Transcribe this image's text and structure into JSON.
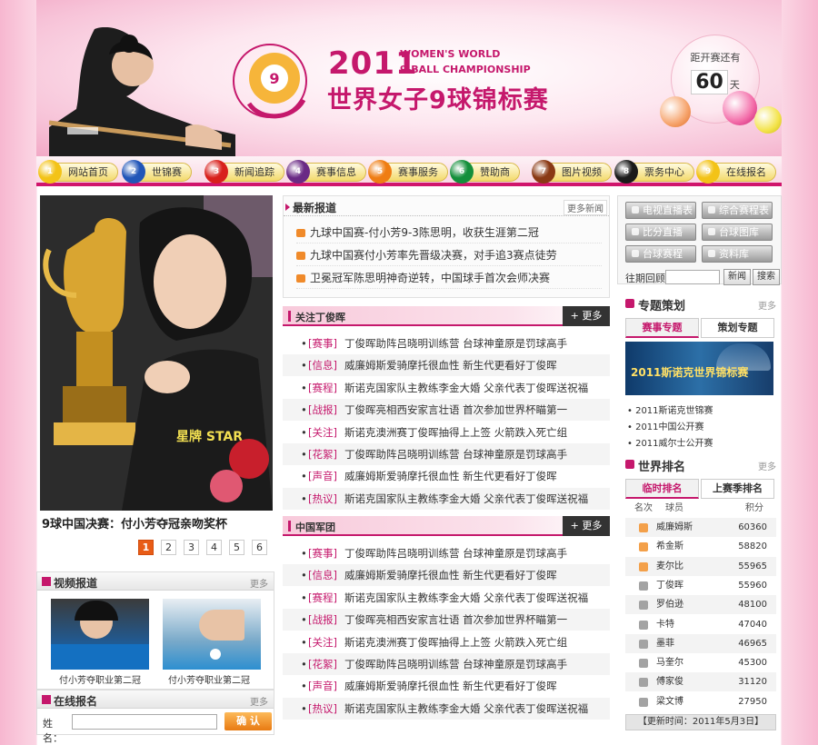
{
  "header": {
    "year": "2011",
    "en_line1": "WOMEN'S WORLD",
    "en_line2": "9-BALL CHAMPIONSHIP",
    "cn_title": "世界女子9球锦标赛",
    "countdown_top": "距开赛还有",
    "countdown_num": "60",
    "countdown_unit": "天",
    "logo_ring_text": "2011世界女子9球锦标赛"
  },
  "nav": [
    {
      "label": "网站首页",
      "num": "1",
      "color": "#f3c317"
    },
    {
      "label": "世锦赛",
      "num": "2",
      "color": "#2155b8"
    },
    {
      "label": "新闻追踪",
      "num": "3",
      "color": "#d8201c"
    },
    {
      "label": "赛事信息",
      "num": "4",
      "color": "#6a2a85"
    },
    {
      "label": "赛事服务",
      "num": "5",
      "color": "#ef7d13"
    },
    {
      "label": "赞助商",
      "num": "6",
      "color": "#148f3b"
    },
    {
      "label": "图片视频",
      "num": "7",
      "color": "#8a3914"
    },
    {
      "label": "票务中心",
      "num": "8",
      "color": "#1a1a1a"
    },
    {
      "label": "在线报名",
      "num": "9",
      "color": "#f3c317"
    }
  ],
  "left": {
    "main_caption": "9球中国决赛：付小芳夺冠亲吻奖杯",
    "jersey_text": "星牌 STAR",
    "pages": [
      "1",
      "2",
      "3",
      "4",
      "5",
      "6"
    ],
    "video": {
      "title": "视频报道",
      "more": "更多",
      "items": [
        "付小芳夺职业第二冠",
        "付小芳夺职业第二冠"
      ]
    },
    "signup": {
      "title": "在线报名",
      "more": "更多",
      "name_label": "姓名：",
      "confirm": "确 认"
    }
  },
  "latest": {
    "title": "最新报道",
    "more": "更多新闻",
    "items": [
      "九球中国赛-付小芳9-3陈思明，收获生涯第二冠",
      "九球中国赛付小芳率先晋级决赛，对手追3赛点徒劳",
      "卫冕冠军陈思明神奇逆转，中国球手首次会师决赛"
    ]
  },
  "ding": {
    "title": "关注丁俊晖",
    "more": "+ 更多",
    "rows": [
      {
        "tag": "[赛事]",
        "text": "丁俊晖助阵吕晓明训练营 台球神童原是罚球高手"
      },
      {
        "tag": "[信息]",
        "text": "威廉姆斯爱骑摩托很血性 新生代更看好丁俊晖"
      },
      {
        "tag": "[赛程]",
        "text": "斯诺克国家队主教练李金大婚 父亲代表丁俊晖送祝福"
      },
      {
        "tag": "[战报]",
        "text": "丁俊晖亮相西安家言壮语 首次参加世界杯瞄第一"
      },
      {
        "tag": "[关注]",
        "text": "斯诺克澳洲赛丁俊晖抽得上上签 火箭跌入死亡组"
      },
      {
        "tag": "[花絮]",
        "text": "丁俊晖助阵吕晓明训练营 台球神童原是罚球高手"
      },
      {
        "tag": "[声音]",
        "text": "威廉姆斯爱骑摩托很血性 新生代更看好丁俊晖"
      },
      {
        "tag": "[热议]",
        "text": "斯诺克国家队主教练李金大婚 父亲代表丁俊晖送祝福"
      }
    ]
  },
  "army": {
    "title": "中国军团",
    "more": "+ 更多",
    "rows": [
      {
        "tag": "[赛事]",
        "text": "丁俊晖助阵吕晓明训练营 台球神童原是罚球高手"
      },
      {
        "tag": "[信息]",
        "text": "威廉姆斯爱骑摩托很血性 新生代更看好丁俊晖"
      },
      {
        "tag": "[赛程]",
        "text": "斯诺克国家队主教练李金大婚 父亲代表丁俊晖送祝福"
      },
      {
        "tag": "[战报]",
        "text": "丁俊晖亮相西安家言壮语 首次参加世界杯瞄第一"
      },
      {
        "tag": "[关注]",
        "text": "斯诺克澳洲赛丁俊晖抽得上上签 火箭跌入死亡组"
      },
      {
        "tag": "[花絮]",
        "text": "丁俊晖助阵吕晓明训练营 台球神童原是罚球高手"
      },
      {
        "tag": "[声音]",
        "text": "威廉姆斯爱骑摩托很血性 新生代更看好丁俊晖"
      },
      {
        "tag": "[热议]",
        "text": "斯诺克国家队主教练李金大婚 父亲代表丁俊晖送祝福"
      }
    ]
  },
  "right": {
    "buttons": [
      "电视直播表",
      "综合赛程表",
      "比分直播",
      "台球图库",
      "台球赛程",
      "资料库"
    ],
    "history_label": "往期回顾：",
    "history_news": "新闻",
    "history_search": "搜索",
    "special": {
      "title": "专题策划",
      "more": "更多",
      "tabs": [
        "赛事专题",
        "策划专题"
      ],
      "banner": "2011斯诺克世界锦标赛",
      "items": [
        "2011斯诺克世锦赛",
        "2011中国公开赛",
        "2011威尔士公开赛"
      ]
    },
    "ranking": {
      "title": "世界排名",
      "more": "更多",
      "tabs": [
        "临时排名",
        "上赛季排名"
      ],
      "col_rank": "名次",
      "col_player": "球员",
      "col_points": "积分",
      "rows": [
        {
          "name": "威廉姆斯",
          "points": "60360"
        },
        {
          "name": "希金斯",
          "points": "58820"
        },
        {
          "name": "麦尔比",
          "points": "55965"
        },
        {
          "name": "丁俊晖",
          "points": "55960"
        },
        {
          "name": "罗伯逊",
          "points": "48100"
        },
        {
          "name": "卡特",
          "points": "47040"
        },
        {
          "name": "墨菲",
          "points": "46965"
        },
        {
          "name": "马奎尔",
          "points": "45300"
        },
        {
          "name": "傅家俊",
          "points": "31120"
        },
        {
          "name": "梁文博",
          "points": "27950"
        }
      ],
      "updated": "【更新时间：2011年5月3日】"
    }
  },
  "colors": {
    "brand": "#c5186c",
    "accent_orange": "#e85c16"
  }
}
